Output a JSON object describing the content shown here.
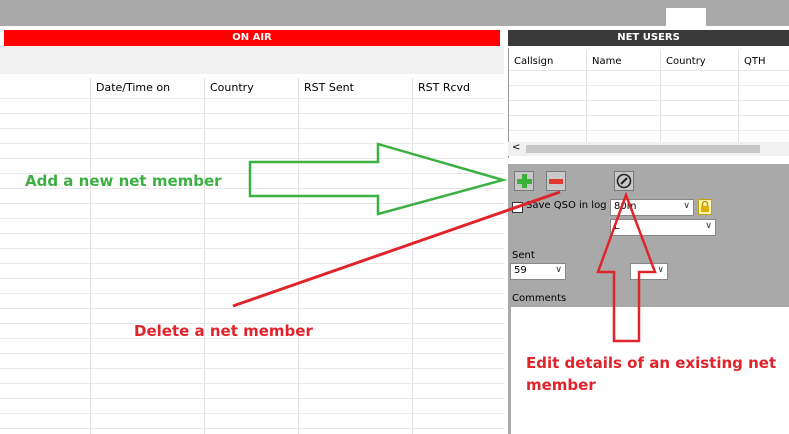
{
  "onair": {
    "title": "ON AIR"
  },
  "log_table": {
    "columns": [
      "Date/Time on",
      "Country",
      "RST Sent",
      "RST Rcvd"
    ]
  },
  "net_users": {
    "title": "NET USERS",
    "columns": [
      "Callsign",
      "Name",
      "Country",
      "QTH"
    ],
    "scroll_left": "<"
  },
  "controls": {
    "save_qso_label": "Save QSO in log",
    "save_qso_checked": false,
    "band_value": "80m",
    "mode_value": "L",
    "sent_label": "Sent",
    "sent_value": "59",
    "comments_label": "Comments"
  },
  "annotations": {
    "add": "Add a new net member",
    "delete": "Delete a net member",
    "edit": "Edit details of an existing net member",
    "colors": {
      "green": "#3cb043",
      "red": "#e0242b"
    }
  },
  "icons": [
    "plus-icon",
    "minus-icon",
    "edit-icon",
    "lock-icon",
    "chevron-down-icon"
  ]
}
